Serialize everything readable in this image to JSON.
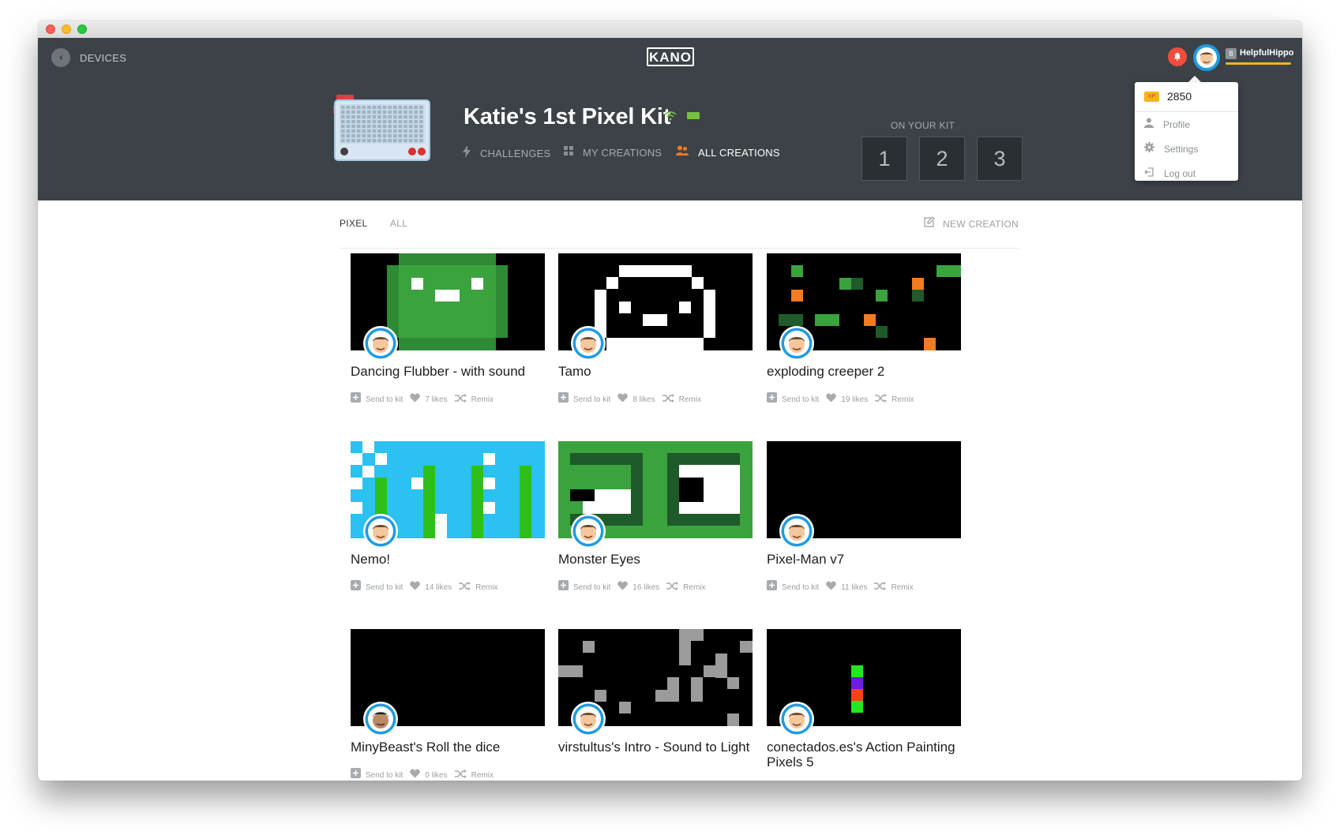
{
  "header": {
    "back_label": "DEVICES",
    "logo_text": "KANO",
    "user": {
      "level": "8",
      "name": "HelpfulHippo"
    },
    "kit_title": "Katie's 1st Pixel Kit",
    "nav": [
      {
        "label": "CHALLENGES",
        "icon": "lightning-icon",
        "active": false
      },
      {
        "label": "MY CREATIONS",
        "icon": "grid-icon",
        "active": false
      },
      {
        "label": "ALL CREATIONS",
        "icon": "people-icon",
        "active": true
      }
    ],
    "on_your_kit": {
      "label": "ON YOUR KIT",
      "slots": [
        "1",
        "2",
        "3"
      ]
    }
  },
  "dropdown": {
    "xp_badge": "XP",
    "xp_value": "2850",
    "items": [
      {
        "label": "Profile",
        "icon": "person-icon"
      },
      {
        "label": "Settings",
        "icon": "gear-icon"
      },
      {
        "label": "Log out",
        "icon": "logout-icon"
      }
    ]
  },
  "tabs": {
    "pixel": "PIXEL",
    "all": "ALL",
    "new_creation": "NEW CREATION"
  },
  "actions": {
    "send": "Send to kit",
    "remix": "Remix"
  },
  "colors": {
    "header_bg": "#3c4247",
    "accent_orange": "#f47c20",
    "xp_yellow": "#f4b41b",
    "bell_red": "#f04d3c",
    "avatar_blue": "#1f9be0"
  },
  "creations": [
    {
      "title": "Dancing Flubber - with sound",
      "likes": "7 likes"
    },
    {
      "title": "Tamo",
      "likes": "8 likes"
    },
    {
      "title": "exploding creeper 2",
      "likes": "19 likes"
    },
    {
      "title": "Nemo!",
      "likes": "14 likes"
    },
    {
      "title": "Monster Eyes",
      "likes": "16 likes"
    },
    {
      "title": "Pixel-Man v7",
      "likes": "11 likes"
    },
    {
      "title": "MinyBeast's Roll the dice",
      "likes": "0 likes"
    },
    {
      "title": "virstultus's Intro - Sound to Light",
      "likes": ""
    },
    {
      "title": "conectados.es's Action Painting Pixels 5",
      "likes": ""
    }
  ]
}
